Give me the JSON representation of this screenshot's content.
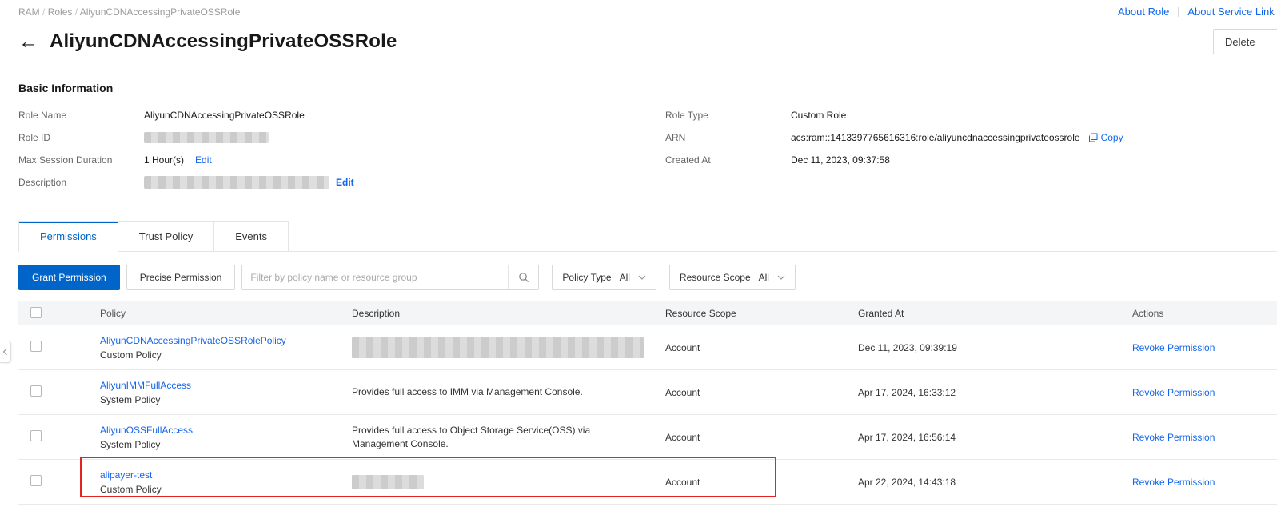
{
  "colors": {
    "accent_blue": "#0064c8",
    "link_blue": "#1366ec",
    "highlight_red": "#e62222"
  },
  "breadcrumb": {
    "items": [
      "RAM",
      "Roles",
      "AliyunCDNAccessingPrivateOSSRole"
    ]
  },
  "header_links": {
    "about_role": "About Role",
    "about_service_linked": "About Service Link"
  },
  "page": {
    "title": "AliyunCDNAccessingPrivateOSSRole",
    "delete_button": "Delete"
  },
  "basic_info": {
    "title": "Basic Information",
    "role_name_label": "Role Name",
    "role_name": "AliyunCDNAccessingPrivateOSSRole",
    "role_id_label": "Role ID",
    "max_session_label": "Max Session Duration",
    "max_session": "1 Hour(s)",
    "max_session_edit": "Edit",
    "description_label": "Description",
    "description_edit": "Edit",
    "role_type_label": "Role Type",
    "role_type": "Custom Role",
    "arn_label": "ARN",
    "arn": "acs:ram::1413397765616316:role/aliyuncdnaccessingprivateossrole",
    "arn_copy": "Copy",
    "created_at_label": "Created At",
    "created_at": "Dec 11, 2023, 09:37:58"
  },
  "tabs": [
    {
      "label": "Permissions",
      "active": true
    },
    {
      "label": "Trust Policy",
      "active": false
    },
    {
      "label": "Events",
      "active": false
    }
  ],
  "toolbar": {
    "grant_permission": "Grant Permission",
    "precise_permission": "Precise Permission",
    "search_placeholder": "Filter by policy name or resource group",
    "policy_type_label": "Policy Type",
    "policy_type_value": "All",
    "resource_scope_label": "Resource Scope",
    "resource_scope_value": "All"
  },
  "table": {
    "columns": [
      "Policy",
      "Description",
      "Resource Scope",
      "Granted At",
      "Actions"
    ],
    "rows": [
      {
        "policy_name": "AliyunCDNAccessingPrivateOSSRolePolicy",
        "policy_type": "Custom Policy",
        "description": "",
        "description_redacted": true,
        "redacted_width": 365,
        "redacted_height": 26,
        "resource_scope": "Account",
        "granted_at": "Dec 11, 2023, 09:39:19",
        "action": "Revoke Permission"
      },
      {
        "policy_name": "AliyunIMMFullAccess",
        "policy_type": "System Policy",
        "description": "Provides full access to IMM via Management Console.",
        "resource_scope": "Account",
        "granted_at": "Apr 17, 2024, 16:33:12",
        "action": "Revoke Permission"
      },
      {
        "policy_name": "AliyunOSSFullAccess",
        "policy_type": "System Policy",
        "description": "Provides full access to Object Storage Service(OSS) via Management Console.",
        "resource_scope": "Account",
        "granted_at": "Apr 17, 2024, 16:56:14",
        "action": "Revoke Permission"
      },
      {
        "policy_name": "alipayer-test",
        "policy_type": "Custom Policy",
        "description": "",
        "description_redacted": true,
        "redacted_width": 90,
        "redacted_height": 18,
        "resource_scope": "Account",
        "granted_at": "Apr 22, 2024, 14:43:18",
        "action": "Revoke Permission",
        "highlighted": true
      }
    ]
  }
}
